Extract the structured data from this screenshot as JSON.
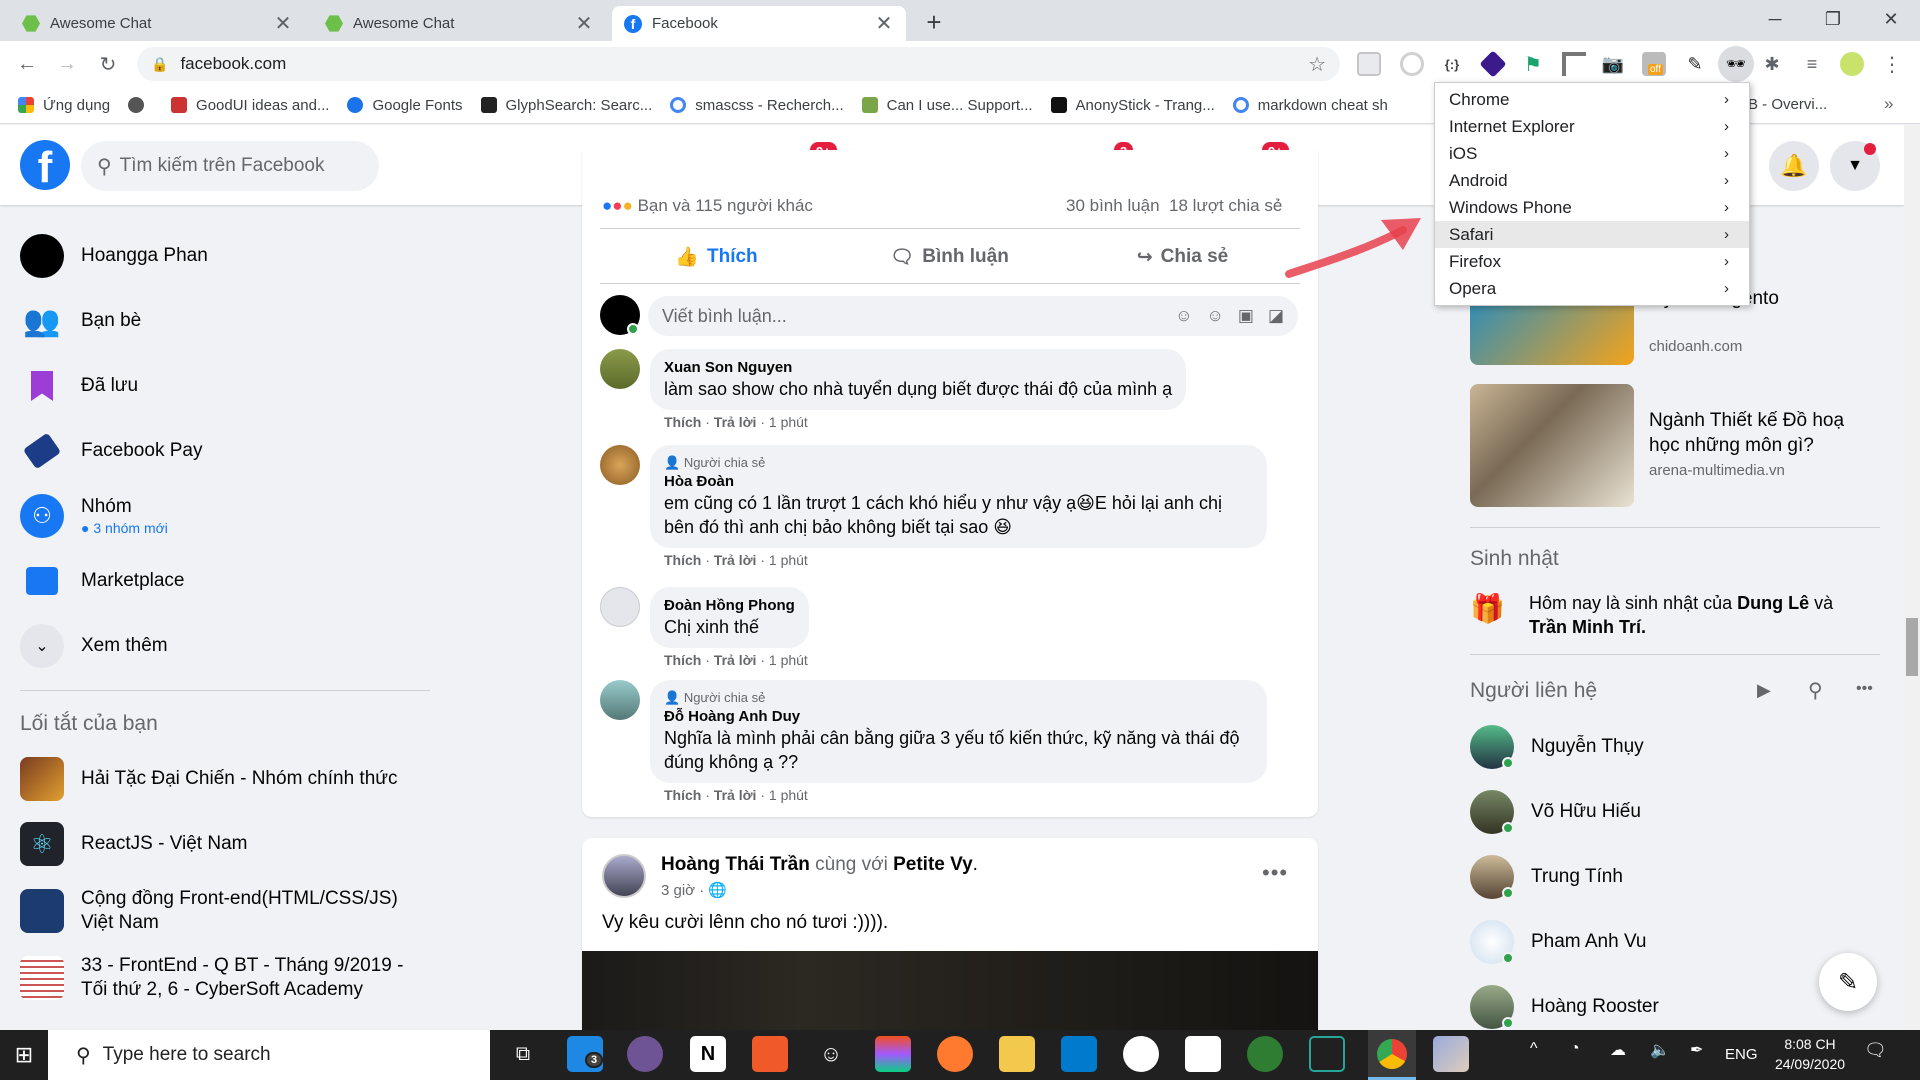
{
  "browser": {
    "tabs": [
      {
        "title": "Awesome Chat",
        "active": false
      },
      {
        "title": "Awesome Chat",
        "active": false
      },
      {
        "title": "Facebook",
        "active": true
      }
    ],
    "new_tab_icon": "plus-icon",
    "url": "facebook.com",
    "bookmarks": [
      "Ứng dụng",
      "GoodUI ideas and...",
      "Google Fonts",
      "GlyphSearch: Searc...",
      "smascss - Recherch...",
      "Can I use... Support...",
      "AnonyStick - Trang...",
      "markdown cheat sh",
      "B - Overvi..."
    ],
    "ext_badge": "off"
  },
  "context_menu": {
    "items": [
      "Chrome",
      "Internet Explorer",
      "iOS",
      "Android",
      "Windows Phone",
      "Safari",
      "Firefox",
      "Opera"
    ],
    "highlighted": "Safari",
    "arrow": "›"
  },
  "fb": {
    "search_placeholder": "Tìm kiếm trên Facebook",
    "nav_badges": {
      "watch": "9+",
      "groups": "3",
      "gaming": "9+"
    },
    "brand_color": "#1877f2",
    "left": {
      "user": "Hoangga Phan",
      "items": [
        "Bạn bè",
        "Đã lưu",
        "Facebook Pay"
      ],
      "groups_label": "Nhóm",
      "groups_sub": "3 nhóm mới",
      "marketplace": "Marketplace",
      "more": "Xem thêm",
      "shortcuts_title": "Lối tắt của bạn",
      "shortcuts": [
        "Hải Tặc Đại Chiến - Nhóm chính thức",
        "ReactJS - Việt Nam",
        "Cộng đồng Front-end(HTML/CSS/JS) Việt Nam",
        "33 - FrontEnd - Q BT - Tháng 9/2019 - Tối thứ 2, 6 - CyberSoft Academy"
      ]
    },
    "post": {
      "reactions_text": "Bạn và 115 người khác",
      "stats_text": "30 bình luận  18 lượt chia sẻ",
      "like": "Thích",
      "comment": "Bình luận",
      "share": "Chia sẻ",
      "comment_placeholder": "Viết bình luận...",
      "comments": [
        {
          "tag": "",
          "name": "Xuan Son Nguyen",
          "text": "làm sao show cho nhà tuyển dụng biết được thái độ của mình ạ",
          "like": "Thích",
          "reply": "Trả lời",
          "time": "1 phút"
        },
        {
          "tag": "Người chia sẻ",
          "name": "Hòa Đoàn",
          "text": "em cũng có 1 lần trượt 1 cách khó hiểu y như vậy ạ😆E hỏi lại anh chị bên đó thì anh chị bảo không biết tại sao 😆",
          "like": "Thích",
          "reply": "Trả lời",
          "time": "1 phút"
        },
        {
          "tag": "",
          "name": "Đoàn Hồng Phong",
          "text": "Chị xinh thế",
          "like": "Thích",
          "reply": "Trả lời",
          "time": "1 phút"
        },
        {
          "tag": "Người chia sẻ",
          "name": "Đỗ Hoàng Anh Duy",
          "text": "Nghĩa là mình phải cân bằng giữa 3 yếu tố kiến thức, kỹ năng và thái độ đúng không ạ ??",
          "like": "Thích",
          "reply": "Trả lời",
          "time": "1 phút"
        }
      ]
    },
    "post2": {
      "author": "Hoàng Thái Trần",
      "with_word": "cùng với",
      "with_name": "Petite Vy",
      "time": "3 giờ",
      "text": "Vy kêu cười lênn cho nó tươi :))))."
    },
    "right": {
      "ads": [
        {
          "title": "alyst - Magento",
          "site": "chidoanh.com"
        },
        {
          "title": "Ngành Thiết kế Đồ hoạ học những môn gì?",
          "site": "arena-multimedia.vn"
        }
      ],
      "birthday_title": "Sinh nhật",
      "birthday_pre": "Hôm nay là sinh nhật của",
      "birthday_name1": "Dung Lê",
      "birthday_and": "và",
      "birthday_name2": "Trần Minh Trí.",
      "contacts_title": "Người liên hệ",
      "contacts": [
        "Nguyễn Thụy",
        "Võ Hữu Hiếu",
        "Trung Tính",
        "Pham Anh Vu",
        "Hoàng Rooster"
      ]
    }
  },
  "taskbar": {
    "search_placeholder": "Type here to search",
    "mail_badge": "3",
    "lang": "ENG",
    "time": "8:08 CH",
    "date": "24/09/2020"
  }
}
